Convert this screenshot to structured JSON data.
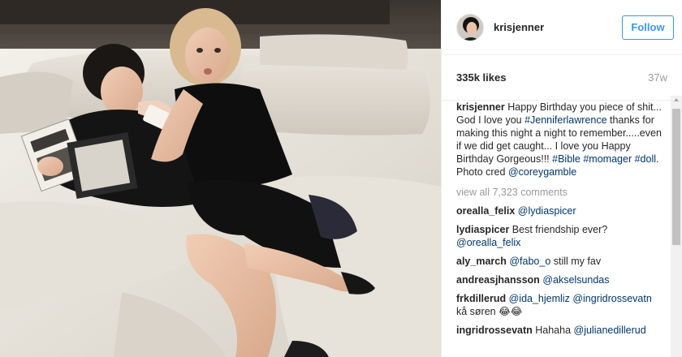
{
  "post": {
    "username": "krisjenner",
    "follow_label": "Follow",
    "likes": "335k likes",
    "age": "37w",
    "caption": {
      "user": "krisjenner",
      "text_1": " Happy Birthday you piece of shit... God I love you ",
      "tag_1": "#Jenniferlawrence",
      "text_2": " thanks for making this night a night to remember.....even if we did get caught... I love you Happy Birthday Gorgeous!!! ",
      "tag_2": "#Bible",
      "tag_3": "#momager",
      "tag_4": "#doll.",
      "text_3": " Photo cred ",
      "tag_5": "@coreygamble"
    },
    "view_all": "view all 7,323 comments",
    "comments": [
      {
        "user": "orealla_felix",
        "mention": "@lydiaspicer",
        "text": ""
      },
      {
        "user": "lydiaspicer",
        "text": " Best friendship ever? ",
        "mention": "@orealla_felix"
      },
      {
        "user": "aly_march",
        "mention": "@fabo_o",
        "text": " still my fav"
      },
      {
        "user": "andreasjhansson",
        "mention": "@akselsundas",
        "text": ""
      },
      {
        "user": "frkdillerud",
        "mention": "@ida_hjemliz",
        "mention_2": "@ingridrossevatn",
        "text": " kå søren 😂😂"
      },
      {
        "user": "ingridrossevatn",
        "text": " Hahaha ",
        "mention": "@julianedillerud"
      }
    ]
  },
  "icons": {
    "avatar": "profile-photo",
    "scroll_up": "arrow-up-icon"
  },
  "colors": {
    "accent": "#3897f0",
    "hashtag": "#003569",
    "muted": "#999999"
  }
}
